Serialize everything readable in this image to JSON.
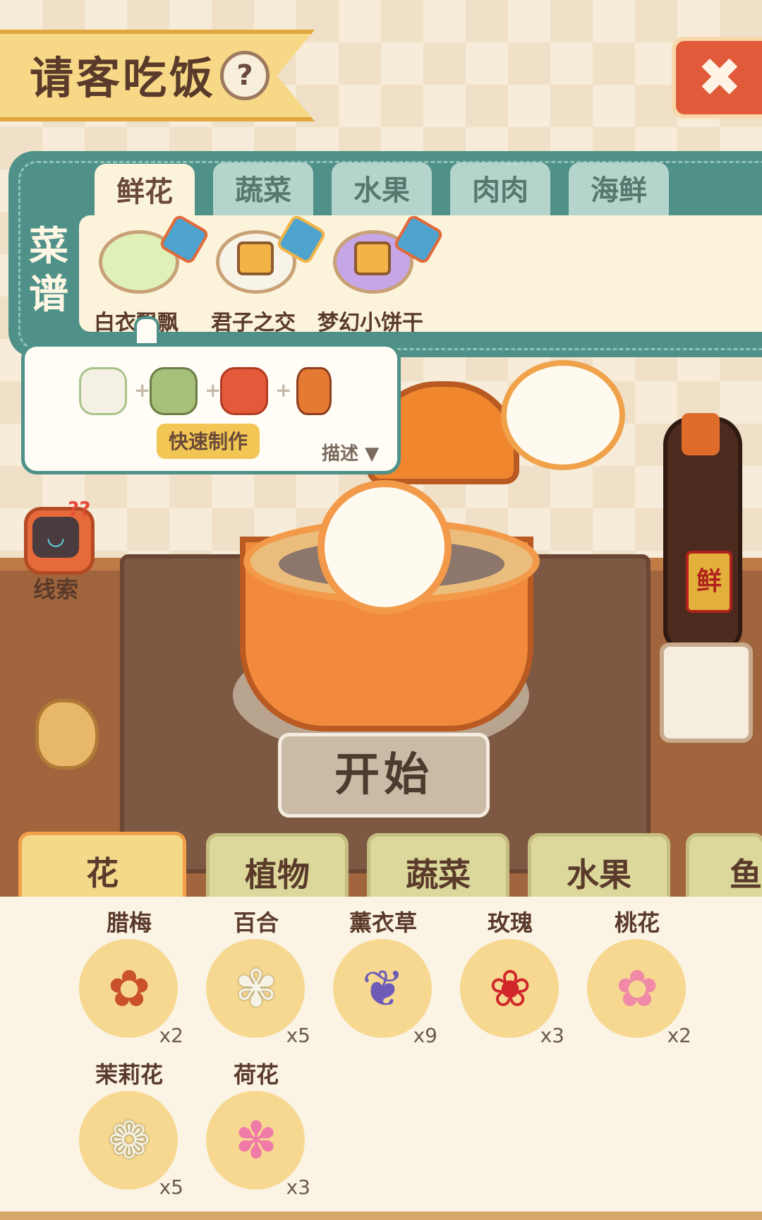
{
  "header": {
    "title": "请客吃饭",
    "help_symbol": "?",
    "close_symbol": "✖"
  },
  "recipe_book": {
    "label": "菜谱",
    "tabs": [
      "鲜花",
      "蔬菜",
      "水果",
      "肉肉",
      "海鲜"
    ],
    "recipes": [
      {
        "name": "白衣飘飘",
        "locked": false
      },
      {
        "name": "君子之交",
        "locked": true
      },
      {
        "name": "梦幻小饼干",
        "locked": true
      }
    ]
  },
  "popup": {
    "plus": "+",
    "quick_make": "快速制作",
    "description": "描述",
    "arrow": "▼"
  },
  "clue": {
    "label": "线索",
    "badge": "??",
    "face": "◡"
  },
  "start_button": "开始",
  "bottle_label": "鲜",
  "categories": [
    "花",
    "植物",
    "蔬菜",
    "水果",
    "鱼"
  ],
  "inventory": [
    {
      "name": "腊梅",
      "count": "x2",
      "icon": "plum-blossom-icon",
      "color": "#c9522c"
    },
    {
      "name": "百合",
      "count": "x5",
      "icon": "lily-icon",
      "color": "#f6f3e6"
    },
    {
      "name": "薰衣草",
      "count": "x9",
      "icon": "lavender-icon",
      "color": "#6d5bb8"
    },
    {
      "name": "玫瑰",
      "count": "x3",
      "icon": "rose-icon",
      "color": "#d0262a"
    },
    {
      "name": "桃花",
      "count": "x2",
      "icon": "peach-blossom-icon",
      "color": "#f08aa6"
    },
    {
      "name": "茉莉花",
      "count": "x5",
      "icon": "jasmine-icon",
      "color": "#f3f0dd"
    },
    {
      "name": "荷花",
      "count": "x3",
      "icon": "lotus-icon",
      "color": "#f07aa8"
    }
  ]
}
